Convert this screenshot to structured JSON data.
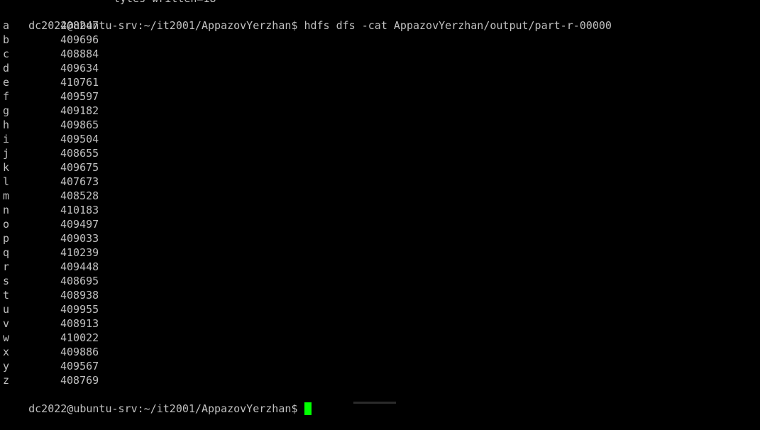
{
  "terminal": {
    "partial_top_line": "lytes written=18",
    "command_line": {
      "prompt": "dc2022@ubuntu-srv:~/it2001/AppazovYerzhan$",
      "command": "hdfs dfs -cat AppazovYerzhan/output/part-r-00000"
    },
    "output_rows": [
      {
        "key": "a",
        "value": "408247"
      },
      {
        "key": "b",
        "value": "409696"
      },
      {
        "key": "c",
        "value": "408884"
      },
      {
        "key": "d",
        "value": "409634"
      },
      {
        "key": "e",
        "value": "410761"
      },
      {
        "key": "f",
        "value": "409597"
      },
      {
        "key": "g",
        "value": "409182"
      },
      {
        "key": "h",
        "value": "409865"
      },
      {
        "key": "i",
        "value": "409504"
      },
      {
        "key": "j",
        "value": "408655"
      },
      {
        "key": "k",
        "value": "409675"
      },
      {
        "key": "l",
        "value": "407673"
      },
      {
        "key": "m",
        "value": "408528"
      },
      {
        "key": "n",
        "value": "410183"
      },
      {
        "key": "o",
        "value": "409497"
      },
      {
        "key": "p",
        "value": "409033"
      },
      {
        "key": "q",
        "value": "410239"
      },
      {
        "key": "r",
        "value": "409448"
      },
      {
        "key": "s",
        "value": "408695"
      },
      {
        "key": "t",
        "value": "408938"
      },
      {
        "key": "u",
        "value": "409955"
      },
      {
        "key": "v",
        "value": "408913"
      },
      {
        "key": "w",
        "value": "410022"
      },
      {
        "key": "x",
        "value": "409886"
      },
      {
        "key": "y",
        "value": "409567"
      },
      {
        "key": "z",
        "value": "408769"
      }
    ],
    "final_prompt": "dc2022@ubuntu-srv:~/it2001/AppazovYerzhan$",
    "colors": {
      "background": "#000000",
      "text": "#c0c0c0",
      "cursor": "#00ff00"
    }
  }
}
